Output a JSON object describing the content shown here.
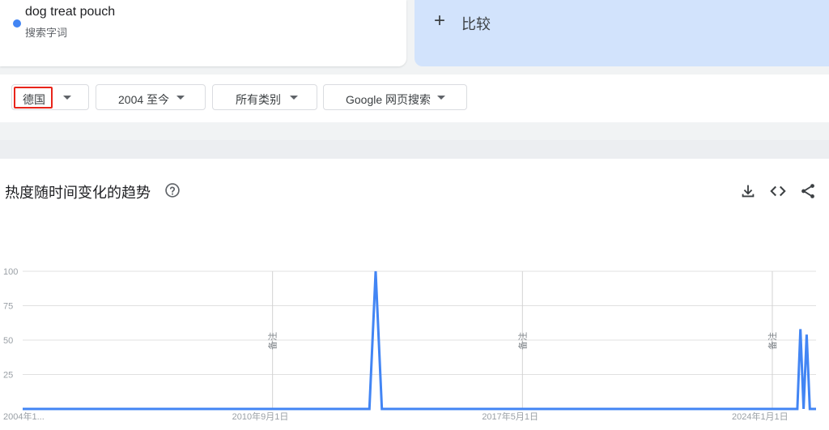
{
  "search_term": {
    "name": "dog treat pouch",
    "type_label": "搜索字词",
    "dot_color": "#4285f4"
  },
  "compare": {
    "plus": "+",
    "label": "比较"
  },
  "filters": {
    "country": "德国",
    "time_range": "2004 至今",
    "category": "所有类别",
    "search_type": "Google 网页搜索"
  },
  "chart_section": {
    "title": "热度随时间变化的趋势",
    "help_icon": "help-circle-icon",
    "tools": [
      "download-icon",
      "embed-code-icon",
      "share-icon"
    ]
  },
  "chart_data": {
    "type": "line",
    "title": "",
    "xlabel": "",
    "ylabel": "",
    "ylim": [
      0,
      100
    ],
    "y_ticks": [
      "100",
      "75",
      "50",
      "25"
    ],
    "x_tick_labels": [
      "2004年1...",
      "2010年9月1日",
      "2017年5月1日",
      "2024年1月1日"
    ],
    "x_range": [
      "2004-01",
      "2025-03"
    ],
    "annotations": [
      "备注",
      "备注",
      "备注"
    ],
    "annotation_dates": [
      "2010-09",
      "2017-05",
      "2024-01"
    ],
    "series": [
      {
        "color": "#4285f4",
        "points": [
          [
            "2004-01",
            0
          ],
          [
            "2013-04",
            0
          ],
          [
            "2013-06",
            100
          ],
          [
            "2013-08",
            0
          ],
          [
            "2024-09",
            0
          ],
          [
            "2024-10",
            58
          ],
          [
            "2024-11",
            0
          ],
          [
            "2024-12",
            54
          ],
          [
            "2025-01",
            0
          ],
          [
            "2025-03",
            0
          ]
        ]
      }
    ]
  }
}
